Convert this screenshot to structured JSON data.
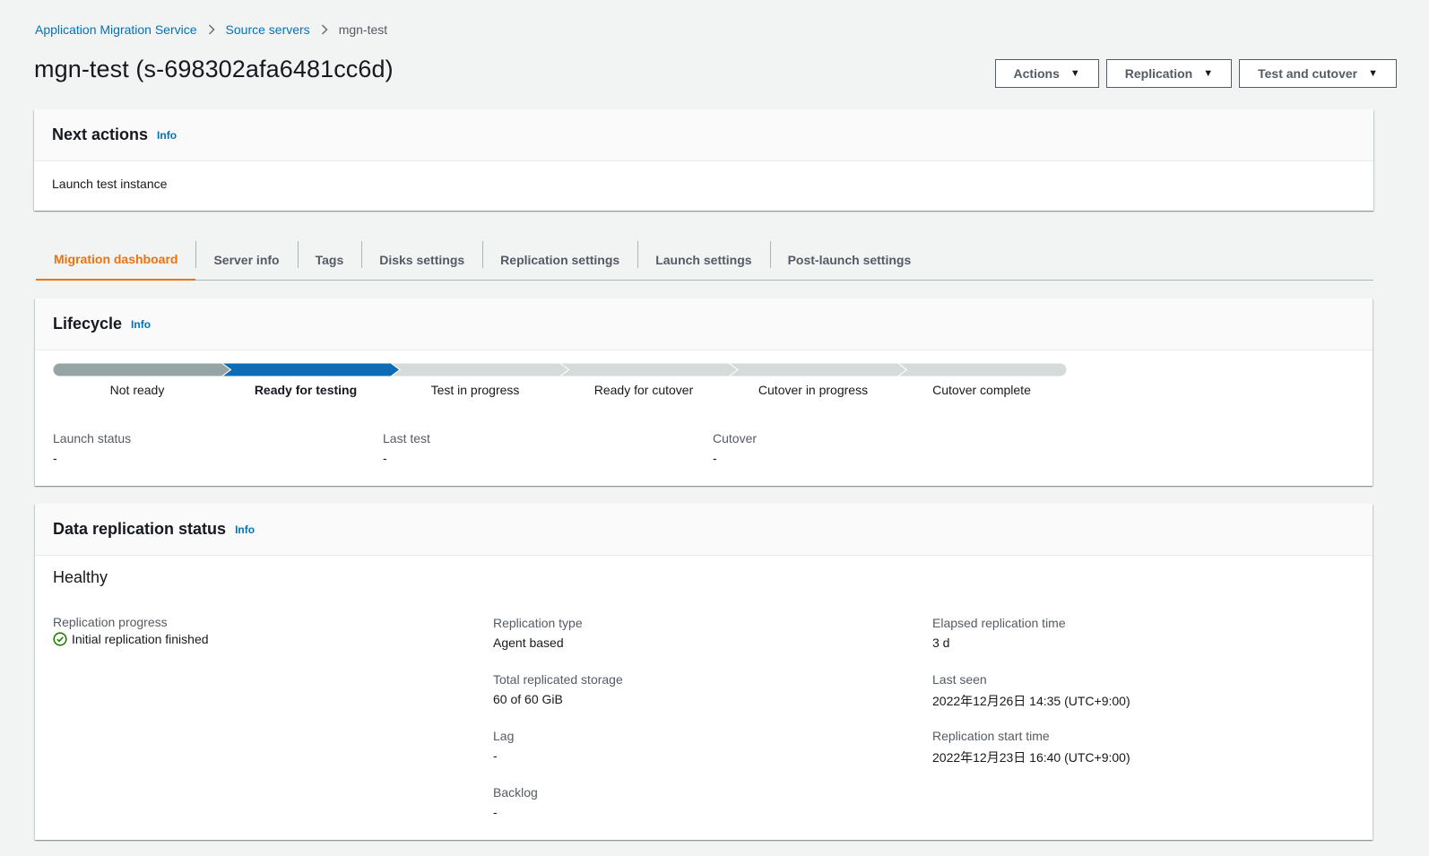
{
  "breadcrumb": {
    "service": "Application Migration Service",
    "source_servers": "Source servers",
    "current": "mgn-test"
  },
  "page_title": "mgn-test (s-698302afa6481cc6d)",
  "header_buttons": {
    "actions": "Actions",
    "replication": "Replication",
    "test_and_cutover": "Test and cutover"
  },
  "next_actions": {
    "title": "Next actions",
    "info": "Info",
    "body": "Launch test instance"
  },
  "tabs": [
    {
      "label": "Migration dashboard",
      "active": true
    },
    {
      "label": "Server info"
    },
    {
      "label": "Tags"
    },
    {
      "label": "Disks settings"
    },
    {
      "label": "Replication settings"
    },
    {
      "label": "Launch settings"
    },
    {
      "label": "Post-launch settings"
    }
  ],
  "lifecycle": {
    "title": "Lifecycle",
    "info": "Info",
    "steps": [
      {
        "label": "Not ready",
        "state": "complete"
      },
      {
        "label": "Ready for testing",
        "state": "current"
      },
      {
        "label": "Test in progress",
        "state": "pending"
      },
      {
        "label": "Ready for cutover",
        "state": "pending"
      },
      {
        "label": "Cutover in progress",
        "state": "pending"
      },
      {
        "label": "Cutover complete",
        "state": "pending"
      }
    ],
    "launch_status": {
      "label": "Launch status",
      "value": "-"
    },
    "last_test": {
      "label": "Last test",
      "value": "-"
    },
    "cutover": {
      "label": "Cutover",
      "value": "-"
    }
  },
  "replication": {
    "title": "Data replication status",
    "info": "Info",
    "health": "Healthy",
    "progress": {
      "label": "Replication progress",
      "value": "Initial replication finished"
    },
    "replication_type": {
      "label": "Replication type",
      "value": "Agent based"
    },
    "total_storage": {
      "label": "Total replicated storage",
      "value": "60 of 60 GiB"
    },
    "lag": {
      "label": "Lag",
      "value": "-"
    },
    "backlog": {
      "label": "Backlog",
      "value": "-"
    },
    "elapsed": {
      "label": "Elapsed replication time",
      "value": "3 d"
    },
    "last_seen": {
      "label": "Last seen",
      "value": "2022年12月26日 14:35 (UTC+9:00)"
    },
    "start_time": {
      "label": "Replication start time",
      "value": "2022年12月23日 16:40 (UTC+9:00)"
    }
  },
  "colors": {
    "link": "#0073bb",
    "active_tab": "#ec7211",
    "step_complete": "#95a5a6",
    "step_current": "#0f6bb4",
    "step_pending": "#d5dbdb",
    "success": "#1d8102"
  }
}
